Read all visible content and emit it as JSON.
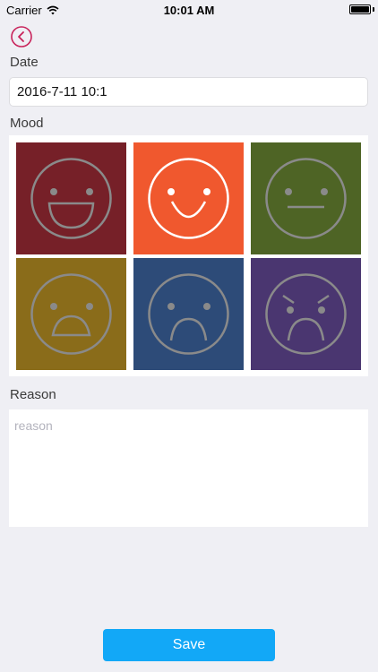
{
  "status_bar": {
    "carrier": "Carrier",
    "time": "10:01 AM"
  },
  "nav": {
    "back_icon": "chevron-left-circle-icon"
  },
  "date_section": {
    "label": "Date",
    "value": "2016-7-11 10:1"
  },
  "mood_section": {
    "label": "Mood",
    "moods": [
      {
        "name": "very-happy",
        "color": "#762028",
        "selected": false
      },
      {
        "name": "happy",
        "color": "#f0582e",
        "selected": true
      },
      {
        "name": "neutral",
        "color": "#4e6425",
        "selected": false
      },
      {
        "name": "shocked",
        "color": "#8a6c1a",
        "selected": false
      },
      {
        "name": "sad",
        "color": "#2d4b78",
        "selected": false
      },
      {
        "name": "angry",
        "color": "#4a3670",
        "selected": false
      }
    ]
  },
  "reason_section": {
    "label": "Reason",
    "placeholder": "reason",
    "value": ""
  },
  "save_label": "Save",
  "colors": {
    "accent": "#12a8f7",
    "back_icon": "#c8225a",
    "background": "#efeff4"
  }
}
